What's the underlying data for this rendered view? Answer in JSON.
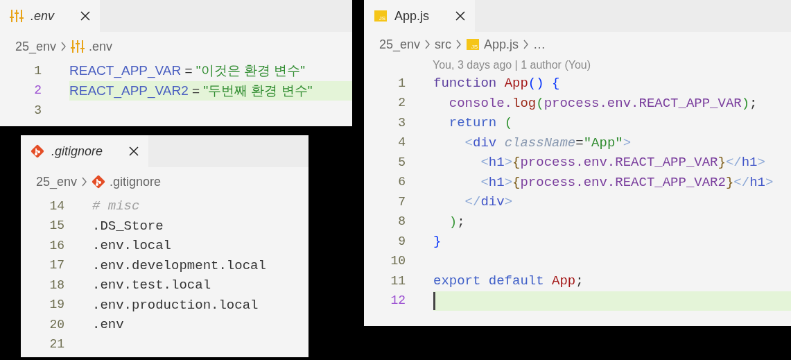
{
  "editors": [
    {
      "kind": "dotenv",
      "tab": {
        "label": ".env",
        "preview": true,
        "icon": {
          "kind": "env"
        }
      },
      "breadcrumb": [
        {
          "label": "25_env"
        },
        {
          "label": ".env",
          "icon": {
            "kind": "env"
          }
        }
      ],
      "lines": [
        {
          "number": "1",
          "current": false,
          "tokens": [
            {
              "text": "REACT_APP_VAR",
              "kind": "key"
            },
            {
              "text": " = ",
              "kind": "punct"
            },
            {
              "text": "\"이것은 환경 변수\"",
              "kind": "string"
            }
          ]
        },
        {
          "number": "2",
          "current": true,
          "tokens": [
            {
              "text": "REACT_APP_VAR2",
              "kind": "key"
            },
            {
              "text": " = ",
              "kind": "punct"
            },
            {
              "text": "\"두번째 환경 변수\"",
              "kind": "string"
            }
          ]
        },
        {
          "number": "3",
          "current": false
        }
      ]
    },
    {
      "kind": "gitignore",
      "tab": {
        "label": ".gitignore",
        "preview": true,
        "icon": {
          "kind": "git"
        }
      },
      "breadcrumb": [
        {
          "label": "25_env"
        },
        {
          "label": ".gitignore",
          "icon": {
            "kind": "git"
          }
        }
      ],
      "lines": [
        {
          "number": "14",
          "current": false,
          "tokens": [
            {
              "text": "# misc",
              "kind": "comment"
            }
          ]
        },
        {
          "number": "15",
          "current": false,
          "tokens": [
            {
              "text": ".DS_Store",
              "kind": "plain"
            }
          ]
        },
        {
          "number": "16",
          "current": false,
          "tokens": [
            {
              "text": ".env.local",
              "kind": "plain"
            }
          ]
        },
        {
          "number": "17",
          "current": false,
          "tokens": [
            {
              "text": ".env.development.local",
              "kind": "plain"
            }
          ]
        },
        {
          "number": "18",
          "current": false,
          "tokens": [
            {
              "text": ".env.test.local",
              "kind": "plain"
            }
          ]
        },
        {
          "number": "19",
          "current": false,
          "tokens": [
            {
              "text": ".env.production.local",
              "kind": "plain"
            }
          ]
        },
        {
          "number": "20",
          "current": false,
          "tokens": [
            {
              "text": ".env",
              "kind": "plain"
            }
          ]
        },
        {
          "number": "21",
          "current": false
        }
      ]
    },
    {
      "kind": "javascript",
      "tab": {
        "label": "App.js",
        "preview": false,
        "icon": {
          "kind": "js",
          "text": "JS"
        }
      },
      "breadcrumb": [
        {
          "label": "25_env"
        },
        {
          "label": "src"
        },
        {
          "label": "App.js",
          "icon": {
            "kind": "js",
            "text": "JS"
          }
        },
        {
          "label": "…"
        }
      ],
      "codelens": "You, 3 days ago | 1 author (You)",
      "lines": [
        {
          "number": "1",
          "current": false,
          "tokens": [
            {
              "text": "function ",
              "kind": "storage"
            },
            {
              "text": "App",
              "kind": "func"
            },
            {
              "text": "() {",
              "kind": "bracket1"
            }
          ]
        },
        {
          "number": "2",
          "current": false,
          "tokens": [
            {
              "text": "  console.",
              "kind": "var"
            },
            {
              "text": "log",
              "kind": "method"
            },
            {
              "text": "(",
              "kind": "bracket2"
            },
            {
              "text": "process.env.REACT_APP_VAR",
              "kind": "var"
            },
            {
              "text": ")",
              "kind": "bracket2"
            },
            {
              "text": ";",
              "kind": "punct"
            }
          ]
        },
        {
          "number": "3",
          "current": false,
          "tokens": [
            {
              "text": "  return ",
              "kind": "control"
            },
            {
              "text": "(",
              "kind": "bracket2"
            }
          ]
        },
        {
          "number": "4",
          "current": false,
          "tokens": [
            {
              "text": "    <",
              "kind": "tagpunct"
            },
            {
              "text": "div",
              "kind": "tag"
            },
            {
              "text": " className",
              "kind": "attr"
            },
            {
              "text": "=",
              "kind": "punct"
            },
            {
              "text": "\"App\"",
              "kind": "string"
            },
            {
              "text": ">",
              "kind": "tagpunct"
            }
          ]
        },
        {
          "number": "5",
          "current": false,
          "tokens": [
            {
              "text": "      <",
              "kind": "tagpunct"
            },
            {
              "text": "h1",
              "kind": "tag"
            },
            {
              "text": ">",
              "kind": "tagpunct"
            },
            {
              "text": "{",
              "kind": "brace"
            },
            {
              "text": "process.env.REACT_APP_VAR",
              "kind": "var"
            },
            {
              "text": "}",
              "kind": "brace"
            },
            {
              "text": "</",
              "kind": "tagpunct"
            },
            {
              "text": "h1",
              "kind": "tag"
            },
            {
              "text": ">",
              "kind": "tagpunct"
            }
          ]
        },
        {
          "number": "6",
          "current": false,
          "tokens": [
            {
              "text": "      <",
              "kind": "tagpunct"
            },
            {
              "text": "h1",
              "kind": "tag"
            },
            {
              "text": ">",
              "kind": "tagpunct"
            },
            {
              "text": "{",
              "kind": "brace"
            },
            {
              "text": "process.env.REACT_APP_VAR2",
              "kind": "var"
            },
            {
              "text": "}",
              "kind": "brace"
            },
            {
              "text": "</",
              "kind": "tagpunct"
            },
            {
              "text": "h1",
              "kind": "tag"
            },
            {
              "text": ">",
              "kind": "tagpunct"
            }
          ]
        },
        {
          "number": "7",
          "current": false,
          "tokens": [
            {
              "text": "    </",
              "kind": "tagpunct"
            },
            {
              "text": "div",
              "kind": "tag"
            },
            {
              "text": ">",
              "kind": "tagpunct"
            }
          ]
        },
        {
          "number": "8",
          "current": false,
          "tokens": [
            {
              "text": "  )",
              "kind": "bracket2"
            },
            {
              "text": ";",
              "kind": "punct"
            }
          ]
        },
        {
          "number": "9",
          "current": false,
          "tokens": [
            {
              "text": "}",
              "kind": "bracket1"
            }
          ]
        },
        {
          "number": "10",
          "current": false
        },
        {
          "number": "11",
          "current": false,
          "tokens": [
            {
              "text": "export default ",
              "kind": "control"
            },
            {
              "text": "App",
              "kind": "func"
            },
            {
              "text": ";",
              "kind": "punct"
            }
          ]
        },
        {
          "number": "12",
          "current": true,
          "cursor": true
        }
      ]
    }
  ]
}
